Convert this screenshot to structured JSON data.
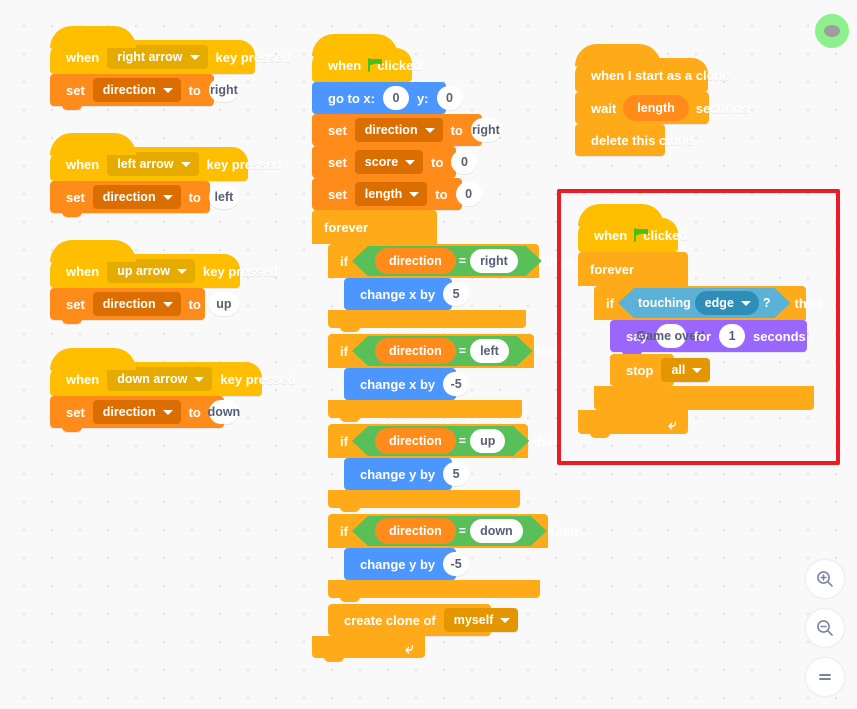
{
  "app": {
    "title": "Scratch Code Workspace",
    "background_color": "#f9f9f9",
    "highlight_color": "#ED1C24"
  },
  "scripts": {
    "key_right": {
      "hat": {
        "when": "when",
        "key": "right arrow",
        "suffix": "key pressed"
      },
      "set": {
        "verb": "set",
        "variable": "direction",
        "to": "to",
        "value": "right"
      }
    },
    "key_left": {
      "hat": {
        "when": "when",
        "key": "left arrow",
        "suffix": "key pressed"
      },
      "set": {
        "verb": "set",
        "variable": "direction",
        "to": "to",
        "value": "left"
      }
    },
    "key_up": {
      "hat": {
        "when": "when",
        "key": "up arrow",
        "suffix": "key pressed"
      },
      "set": {
        "verb": "set",
        "variable": "direction",
        "to": "to",
        "value": "up"
      }
    },
    "key_down": {
      "hat": {
        "when": "when",
        "key": "down arrow",
        "suffix": "key pressed"
      },
      "set": {
        "verb": "set",
        "variable": "direction",
        "to": "to",
        "value": "down"
      }
    },
    "main": {
      "hat": {
        "when": "when",
        "clicked": "clicked"
      },
      "goto": {
        "label_x": "go to x:",
        "x": "0",
        "label_y": "y:",
        "y": "0"
      },
      "set_direction": {
        "verb": "set",
        "variable": "direction",
        "to": "to",
        "value": "right"
      },
      "set_score": {
        "verb": "set",
        "variable": "score",
        "to": "to",
        "value": "0"
      },
      "set_length": {
        "verb": "set",
        "variable": "length",
        "to": "to",
        "value": "0"
      },
      "forever": "forever",
      "if_right": {
        "if": "if",
        "operand_a": "direction",
        "operator": "=",
        "operand_b": "right",
        "then": "then",
        "body": {
          "label": "change x by",
          "value": "5"
        }
      },
      "if_left": {
        "if": "if",
        "operand_a": "direction",
        "operator": "=",
        "operand_b": "left",
        "then": "then",
        "body": {
          "label": "change x by",
          "value": "-5"
        }
      },
      "if_up": {
        "if": "if",
        "operand_a": "direction",
        "operator": "=",
        "operand_b": "up",
        "then": "then",
        "body": {
          "label": "change y by",
          "value": "5"
        }
      },
      "if_down": {
        "if": "if",
        "operand_a": "direction",
        "operator": "=",
        "operand_b": "down",
        "then": "then",
        "body": {
          "label": "change y by",
          "value": "-5"
        }
      },
      "create_clone": {
        "label": "create clone of",
        "target": "myself"
      }
    },
    "clone": {
      "hat": "when I start as a clone",
      "wait": {
        "label": "wait",
        "variable": "length",
        "suffix": "seconds"
      },
      "delete": "delete this clone"
    },
    "game_over": {
      "hat": {
        "when": "when",
        "clicked": "clicked"
      },
      "forever": "forever",
      "if_touching": {
        "if": "if",
        "touching": "touching",
        "target": "edge",
        "question": "?",
        "then": "then"
      },
      "say": {
        "verb": "say",
        "message": "Game over!",
        "for": "for",
        "seconds_value": "1",
        "seconds": "seconds"
      },
      "stop": {
        "verb": "stop",
        "target": "all"
      }
    }
  },
  "zoom_controls": {
    "zoom_in": "zoom-in",
    "zoom_out": "zoom-out",
    "zoom_reset": "zoom-reset"
  }
}
